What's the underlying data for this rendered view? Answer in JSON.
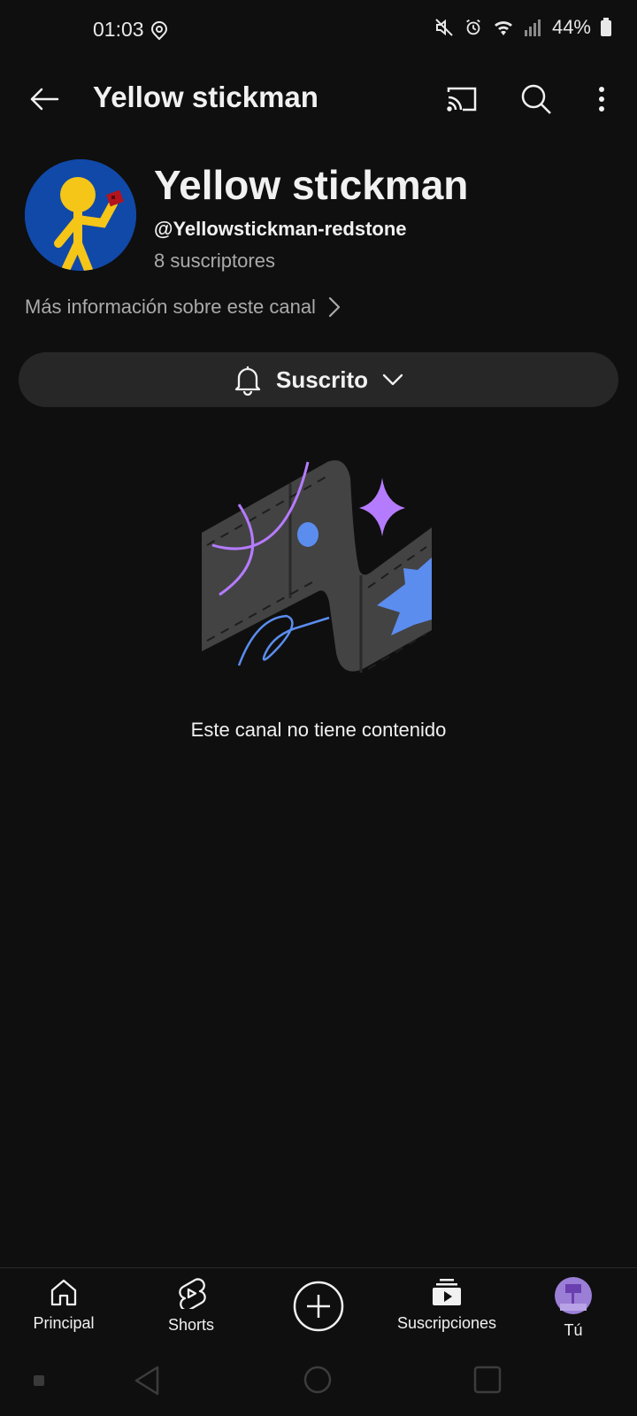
{
  "status_bar": {
    "time": "01:03",
    "battery": "44%",
    "icons": [
      "hotspot-icon",
      "mute-icon",
      "alarm-icon",
      "wifi-icon",
      "signal-icon",
      "battery-icon"
    ]
  },
  "top_bar": {
    "title": "Yellow stickman",
    "icons": [
      "back-arrow-icon",
      "cast-icon",
      "search-icon",
      "more-vert-icon"
    ]
  },
  "channel": {
    "name": "Yellow stickman",
    "handle": "@Yellowstickman-redstone",
    "subscribers": "8 suscriptores",
    "more_info": "Más información sobre este canal"
  },
  "subscribe": {
    "label": "Suscrito"
  },
  "empty_state": {
    "message": "Este canal no tiene contenido"
  },
  "bottom_nav": {
    "items": [
      {
        "label": "Principal",
        "icon": "home-icon"
      },
      {
        "label": "Shorts",
        "icon": "shorts-icon"
      },
      {
        "label": "",
        "icon": "create-plus-icon"
      },
      {
        "label": "Suscripciones",
        "icon": "subscriptions-icon"
      },
      {
        "label": "Tú",
        "icon": "profile-avatar"
      }
    ]
  },
  "colors": {
    "background": "#0f0f0f",
    "pill": "#272727",
    "secondary_text": "#aaaaaa",
    "avatar_blue": "#1149a8",
    "stickman_yellow": "#f5c518",
    "accent_purple": "#b57bff",
    "accent_blue": "#5b8def"
  }
}
